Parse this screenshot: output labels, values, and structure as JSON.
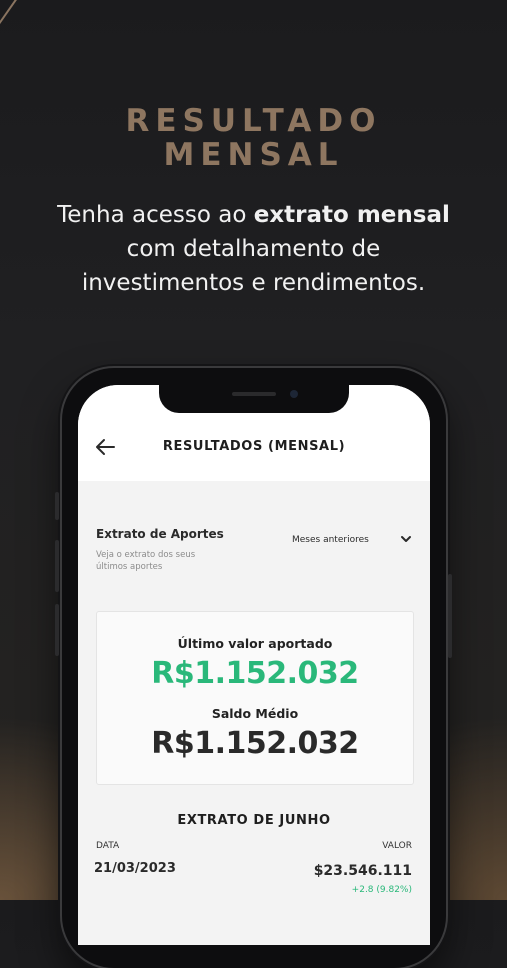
{
  "promo": {
    "headline_line1": "RESULTADO",
    "headline_line2": "MENSAL",
    "subtitle_pre": "Tenha acesso ao ",
    "subtitle_bold": "extrato mensal",
    "subtitle_line2": "com detalhamento de",
    "subtitle_line3": "investimentos e rendimentos."
  },
  "app": {
    "title": "RESULTADOS (MENSAL)",
    "back_icon": "arrow-left-icon",
    "section": {
      "title": "Extrato de Aportes",
      "description": "Veja o extrato dos seus\n últimos aportes",
      "dropdown_value": "Meses anteriores",
      "dropdown_icon": "chevron-down-icon"
    },
    "summary": {
      "last_label": "Último valor aportado",
      "last_value": "R$1.152.032",
      "avg_label": "Saldo Médio",
      "avg_value": "R$1.152.032"
    },
    "statement": {
      "title": "EXTRATO DE JUNHO",
      "col_date": "DATA",
      "col_value": "VALOR",
      "rows": [
        {
          "date": "21/03/2023",
          "value": "$23.546.111",
          "change": "+2.8 (9.82%)"
        }
      ]
    }
  },
  "colors": {
    "accent_green": "#2ab87a",
    "headline_bronze": "#8e7660",
    "dark_text": "#2a2a2a"
  }
}
